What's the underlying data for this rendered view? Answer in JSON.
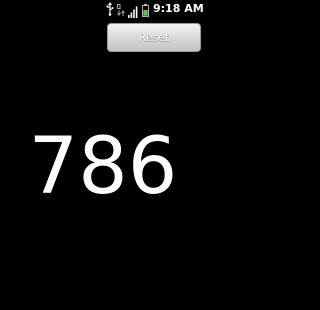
{
  "status_bar": {
    "time": "9:18 AM",
    "icons": [
      "usb-icon",
      "data-activity-icon",
      "signal-icon",
      "battery-icon"
    ]
  },
  "toolbar": {
    "reset_label": "Reset"
  },
  "counter": {
    "value": "786"
  },
  "colors": {
    "background": "#000000",
    "text": "#ffffff",
    "button": "#d7d7d7"
  }
}
